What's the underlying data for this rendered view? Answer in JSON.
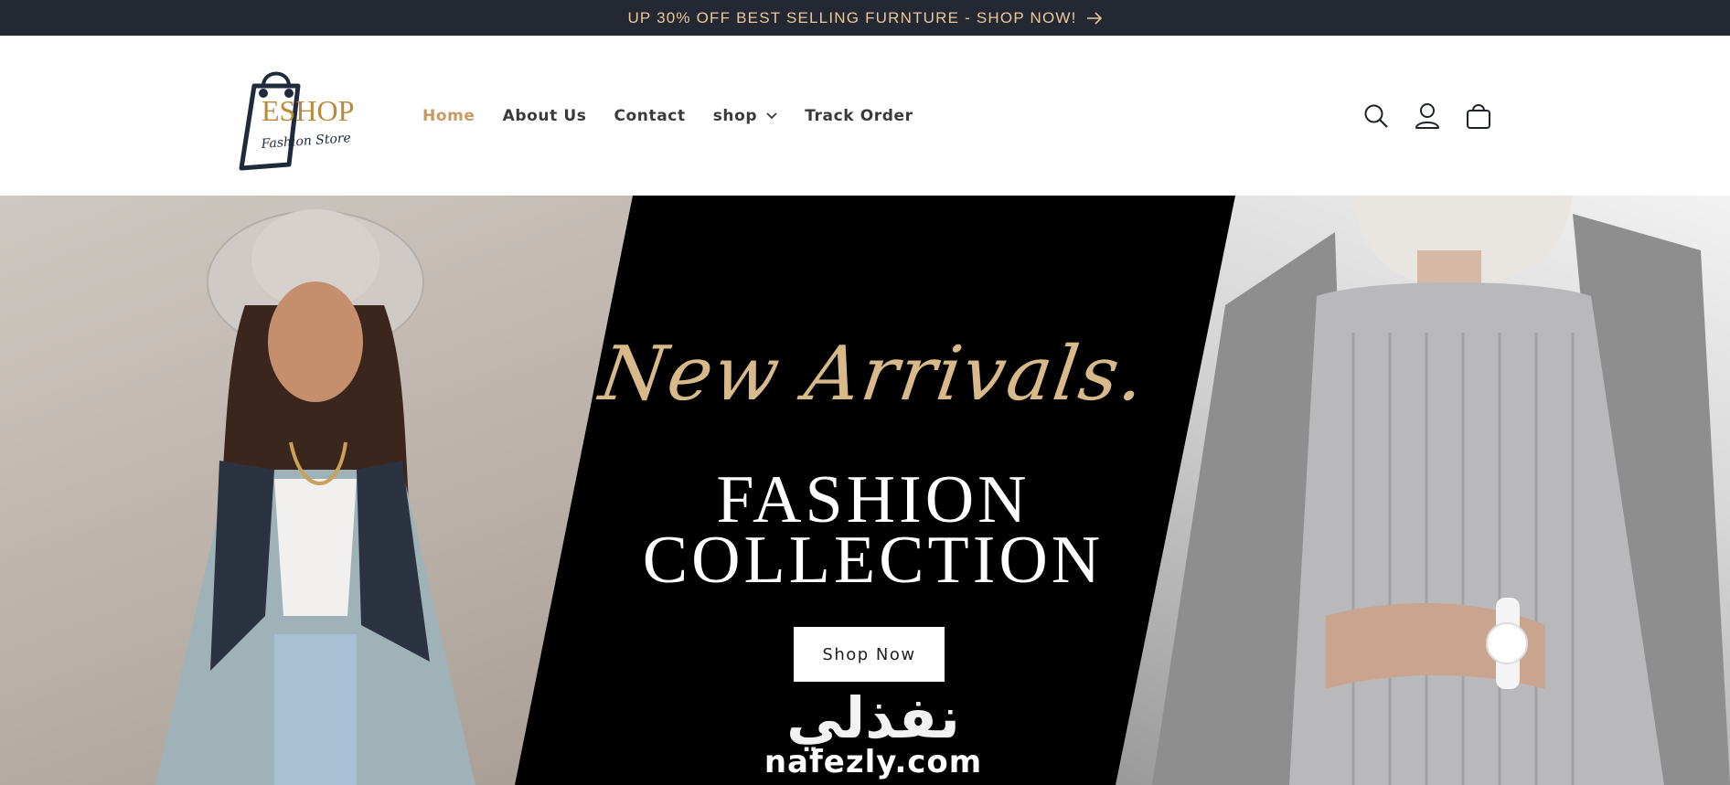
{
  "announcement": {
    "text": "UP 30% OFF BEST SELLING FURNTURE - SHOP NOW!",
    "arrow_icon": "arrow-right-icon"
  },
  "brand": {
    "logo_title": "ESHOP",
    "logo_subtitle": "Fashion Store",
    "accent_color": "#c89a62"
  },
  "nav": {
    "items": [
      {
        "label": "Home",
        "active": true
      },
      {
        "label": "About Us",
        "active": false
      },
      {
        "label": "Contact",
        "active": false
      },
      {
        "label": "shop",
        "active": false,
        "dropdown": true
      },
      {
        "label": "Track Order",
        "active": false
      }
    ]
  },
  "header_icons": [
    "search-icon",
    "account-icon",
    "cart-icon"
  ],
  "hero": {
    "script_title": "New Arrivals.",
    "headline_line1": "FASHION",
    "headline_line2": "COLLECTION",
    "button_label": "Shop Now",
    "watermark_arabic": "نفذلي",
    "watermark_latin": "nafezly.com"
  },
  "colors": {
    "announcement_bg": "#242833",
    "announcement_text": "#e9c89c",
    "hero_bg": "#000000"
  }
}
